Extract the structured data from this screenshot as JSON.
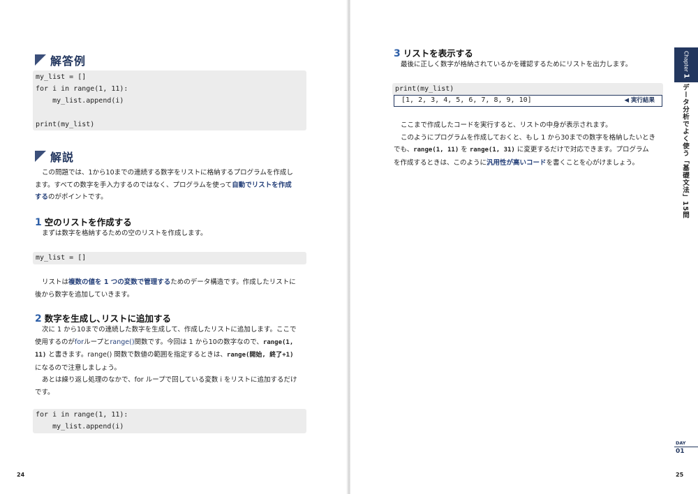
{
  "left": {
    "answer_heading": "解答例",
    "answer_code": [
      "my_list = []",
      "for i in range(1, 11):",
      "    my_list.append(i)",
      "",
      "print(my_list)"
    ],
    "explain_heading": "解説",
    "intro": {
      "l1": "この問題では、1から10までの連続する数字をリストに格納するプログラムを作成し",
      "l2_pre": "ます。すべての数字を手入力するのではなく、プログラムを使って",
      "l2_em": "自動でリストを作成",
      "l3_em": "する",
      "l3_post": "のがポイントです。"
    },
    "s1": {
      "num": "1",
      "title": "空のリストを作成する",
      "lead": "まずは数字を格納するための空のリストを作成します。",
      "code": [
        "my_list = []"
      ],
      "b1_pre": "リストは",
      "b1_em": "複数の値を 1 つの変数で管理する",
      "b1_post": "ためのデータ構造です。作成したリストに",
      "b2": "後から数字を追加していきます。"
    },
    "s2": {
      "num": "2",
      "title": "数字を生成し､リストに追加する",
      "l1": "次に 1 から10までの連続した数字を生成して、作成したリストに追加します。ここで",
      "l2_a": "使用するのが",
      "l2_for": "for",
      "l2_b": "ループと",
      "l2_range": "range()",
      "l2_c": "関数です。今回は 1 から10の数字なので、",
      "l2_code": "range(1,",
      "l3_code": "11)",
      "l3_a": "と書きます。range() 関数で数値の範囲を指定するときは、",
      "l3_code2": "range(開始, 終了+1)",
      "l4": "になるので注意しましょう。",
      "l5": "あとは繰り返し処理のなかで、for ループで回している変数 i をリストに追加するだけ",
      "l6": "です。",
      "code": [
        "for i in range(1, 11):",
        "    my_list.append(i)"
      ]
    },
    "page_number": "24"
  },
  "right": {
    "s3": {
      "num": "3",
      "title": "リストを表示する",
      "lead": "最後に正しく数字が格納されているかを確認するためにリストを出力します。",
      "code": "print(my_list)",
      "result": "[1, 2, 3, 4, 5, 6, 7, 8, 9, 10]",
      "result_tag": "◀ 実行結果"
    },
    "body": {
      "l1": "ここまで作成したコードを実行すると、リストの中身が表示されます。",
      "l2": "このようにプログラムを作成しておくと、もし 1 から30までの数字を格納したいとき",
      "l3_a": "でも、",
      "l3_c1": "range(1, 11)",
      "l3_b": "を",
      "l3_c2": "range(1, 31)",
      "l3_c": "に変更するだけで対応できます。プログラム",
      "l4_a": "を作成するときは、このように",
      "l4_em": "汎用性が高いコード",
      "l4_b": "を書くことを心がけましょう。"
    },
    "chapter_label": "Chapter",
    "chapter_num": "1",
    "side_title": "データ分析でよく使う「基礎文法」15問",
    "day_label": "DAY",
    "day_num": "01",
    "page_number": "25"
  }
}
